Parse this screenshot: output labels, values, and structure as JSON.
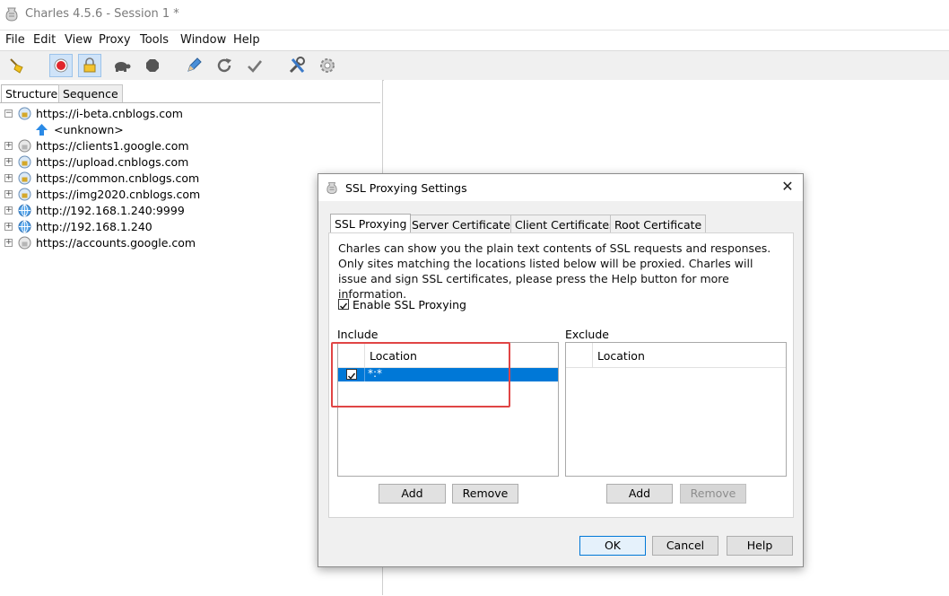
{
  "window": {
    "title": "Charles 4.5.6 - Session 1 *"
  },
  "menu": [
    "File",
    "Edit",
    "View",
    "Proxy",
    "Tools",
    "Window",
    "Help"
  ],
  "toolbar": {
    "icons": [
      "broom-icon",
      "record-icon",
      "ssl-lock-icon",
      "turtle-icon",
      "stop-icon",
      "pen-icon",
      "refresh-icon",
      "check-icon",
      "tools-icon",
      "gear-icon"
    ]
  },
  "left_pane": {
    "tabs": [
      "Structure",
      "Sequence"
    ],
    "tree": [
      {
        "label": "https://i-beta.cnblogs.com",
        "expanded": true
      },
      {
        "label": "<unknown>",
        "child": true
      },
      {
        "label": "https://clients1.google.com"
      },
      {
        "label": "https://upload.cnblogs.com"
      },
      {
        "label": "https://common.cnblogs.com"
      },
      {
        "label": "https://img2020.cnblogs.com"
      },
      {
        "label": "http://192.168.1.240:9999"
      },
      {
        "label": "http://192.168.1.240"
      },
      {
        "label": "https://accounts.google.com"
      }
    ]
  },
  "dialog": {
    "title": "SSL Proxying Settings",
    "tabs": [
      "SSL Proxying",
      "Server Certificates",
      "Client Certificates",
      "Root Certificate"
    ],
    "description": "Charles can show you the plain text contents of SSL requests and responses. Only sites matching the locations listed below will be proxied. Charles will issue and sign SSL certificates, please press the Help button for more information.",
    "enable_label": "Enable SSL Proxying",
    "include": {
      "label": "Include",
      "column": "Location",
      "rows": [
        "*:*"
      ],
      "add": "Add",
      "remove": "Remove"
    },
    "exclude": {
      "label": "Exclude",
      "column": "Location",
      "add": "Add",
      "remove": "Remove"
    },
    "ok": "OK",
    "cancel": "Cancel",
    "help": "Help"
  },
  "colors": {
    "selection": "#0078d7",
    "highlight_box": "#e04545"
  }
}
